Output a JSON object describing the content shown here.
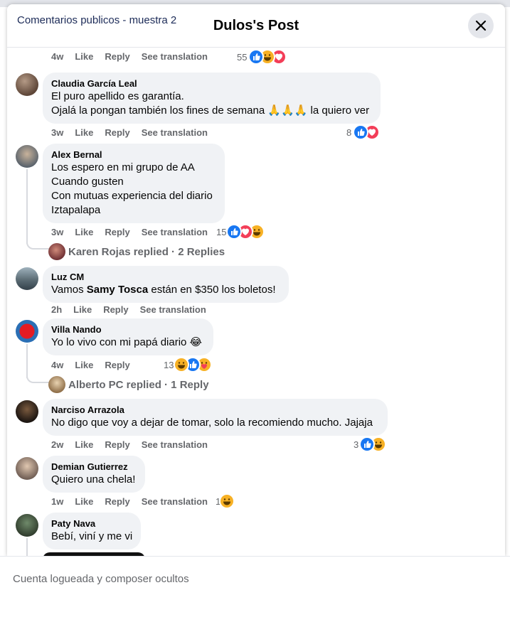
{
  "header": {
    "sample_label": "Comentarios publicos - muestra 2",
    "post_title": "Dulos's Post"
  },
  "actions": {
    "like": "Like",
    "reply": "Reply",
    "see_translation": "See translation"
  },
  "top_meta": {
    "time": "4w",
    "reaction_count": "55",
    "reactions": [
      "haha",
      "like",
      "love"
    ]
  },
  "comments": [
    {
      "name": "Claudia García Leal",
      "lines": [
        "El puro apellido es garantía.",
        "Ojalá la pongan también los fines de semana 🙏🙏🙏 la quiero ver"
      ],
      "time": "3w",
      "reaction_count": "8",
      "reactions": [
        "like",
        "love"
      ],
      "translatable": true
    },
    {
      "name": "Alex Bernal",
      "lines": [
        "Los espero en mi grupo de AA",
        "Cuando gusten",
        "Con mutuas experiencia del diario",
        "Iztapalapa"
      ],
      "time": "3w",
      "reaction_count": "15",
      "reactions": [
        "like",
        "love",
        "haha"
      ],
      "translatable": true,
      "replies": "Karen Rojas replied · 2 Replies"
    },
    {
      "name": "Luz CM",
      "line_prefix": "Vamos ",
      "line_bold": "Samy Tosca",
      "line_suffix": " están en $350 los boletos!",
      "time": "2h",
      "translatable": true
    },
    {
      "name": "Villa Nando",
      "lines": [
        "Yo lo vivo con mi papá diario 😂"
      ],
      "time": "4w",
      "reaction_count": "13",
      "reactions": [
        "haha",
        "like",
        "care"
      ],
      "translatable": false,
      "replies": "Alberto PC replied · 1 Reply"
    },
    {
      "name": "Narciso Arrazola",
      "lines": [
        "No digo que voy a dejar de tomar, solo la recomiendo mucho. Jajaja"
      ],
      "time": "2w",
      "reaction_count": "3",
      "reactions": [
        "like",
        "haha"
      ],
      "translatable": true
    },
    {
      "name": "Demian Gutierrez",
      "lines": [
        "Quiero una chela!"
      ],
      "time": "1w",
      "reaction_count": "1",
      "reactions": [
        "haha"
      ],
      "translatable": true
    },
    {
      "name": "Paty Nava",
      "lines": [
        "Bebí, viní y me vi"
      ]
    }
  ],
  "footer": {
    "note": "Cuenta logueada y composer ocultos"
  },
  "colors": {
    "like": "#1877f2",
    "love": "#f33e58",
    "haha": "#f7b125",
    "care": "#f7b125",
    "bubble": "#f0f2f5",
    "meta": "#65676b"
  }
}
